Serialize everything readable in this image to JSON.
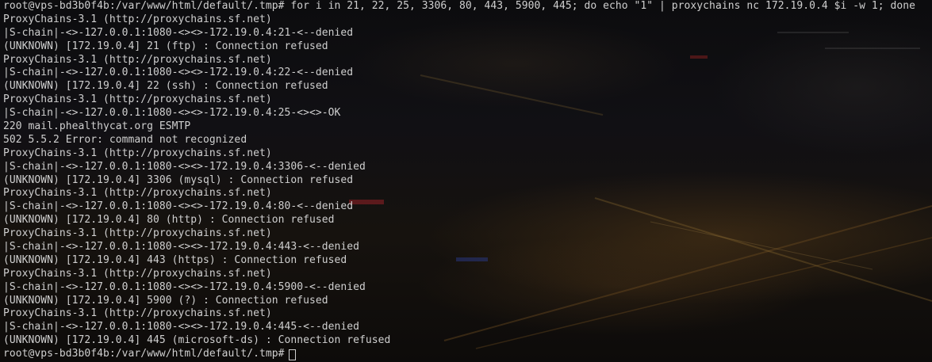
{
  "terminal": {
    "command_line": "root@vps-bd3b0f4b:/var/www/html/default/.tmp# for i in 21, 22, 25, 3306, 80, 443, 5900, 445; do echo \"1\" | proxychains nc 172.19.0.4 $i -w 1; done",
    "output": [
      "ProxyChains-3.1 (http://proxychains.sf.net)",
      "|S-chain|-<>-127.0.0.1:1080-<><>-172.19.0.4:21-<--denied",
      "(UNKNOWN) [172.19.0.4] 21 (ftp) : Connection refused",
      "ProxyChains-3.1 (http://proxychains.sf.net)",
      "|S-chain|-<>-127.0.0.1:1080-<><>-172.19.0.4:22-<--denied",
      "(UNKNOWN) [172.19.0.4] 22 (ssh) : Connection refused",
      "ProxyChains-3.1 (http://proxychains.sf.net)",
      "|S-chain|-<>-127.0.0.1:1080-<><>-172.19.0.4:25-<><>-OK",
      "220 mail.phealthycat.org ESMTP",
      "502 5.5.2 Error: command not recognized",
      "ProxyChains-3.1 (http://proxychains.sf.net)",
      "|S-chain|-<>-127.0.0.1:1080-<><>-172.19.0.4:3306-<--denied",
      "(UNKNOWN) [172.19.0.4] 3306 (mysql) : Connection refused",
      "ProxyChains-3.1 (http://proxychains.sf.net)",
      "|S-chain|-<>-127.0.0.1:1080-<><>-172.19.0.4:80-<--denied",
      "(UNKNOWN) [172.19.0.4] 80 (http) : Connection refused",
      "ProxyChains-3.1 (http://proxychains.sf.net)",
      "|S-chain|-<>-127.0.0.1:1080-<><>-172.19.0.4:443-<--denied",
      "(UNKNOWN) [172.19.0.4] 443 (https) : Connection refused",
      "ProxyChains-3.1 (http://proxychains.sf.net)",
      "|S-chain|-<>-127.0.0.1:1080-<><>-172.19.0.4:5900-<--denied",
      "(UNKNOWN) [172.19.0.4] 5900 (?) : Connection refused",
      "ProxyChains-3.1 (http://proxychains.sf.net)",
      "|S-chain|-<>-127.0.0.1:1080-<><>-172.19.0.4:445-<--denied",
      "(UNKNOWN) [172.19.0.4] 445 (microsoft-ds) : Connection refused"
    ],
    "prompt": "root@vps-bd3b0f4b:/var/www/html/default/.tmp#",
    "colors": {
      "text": "#cfcfcf",
      "background": "#111014"
    }
  }
}
